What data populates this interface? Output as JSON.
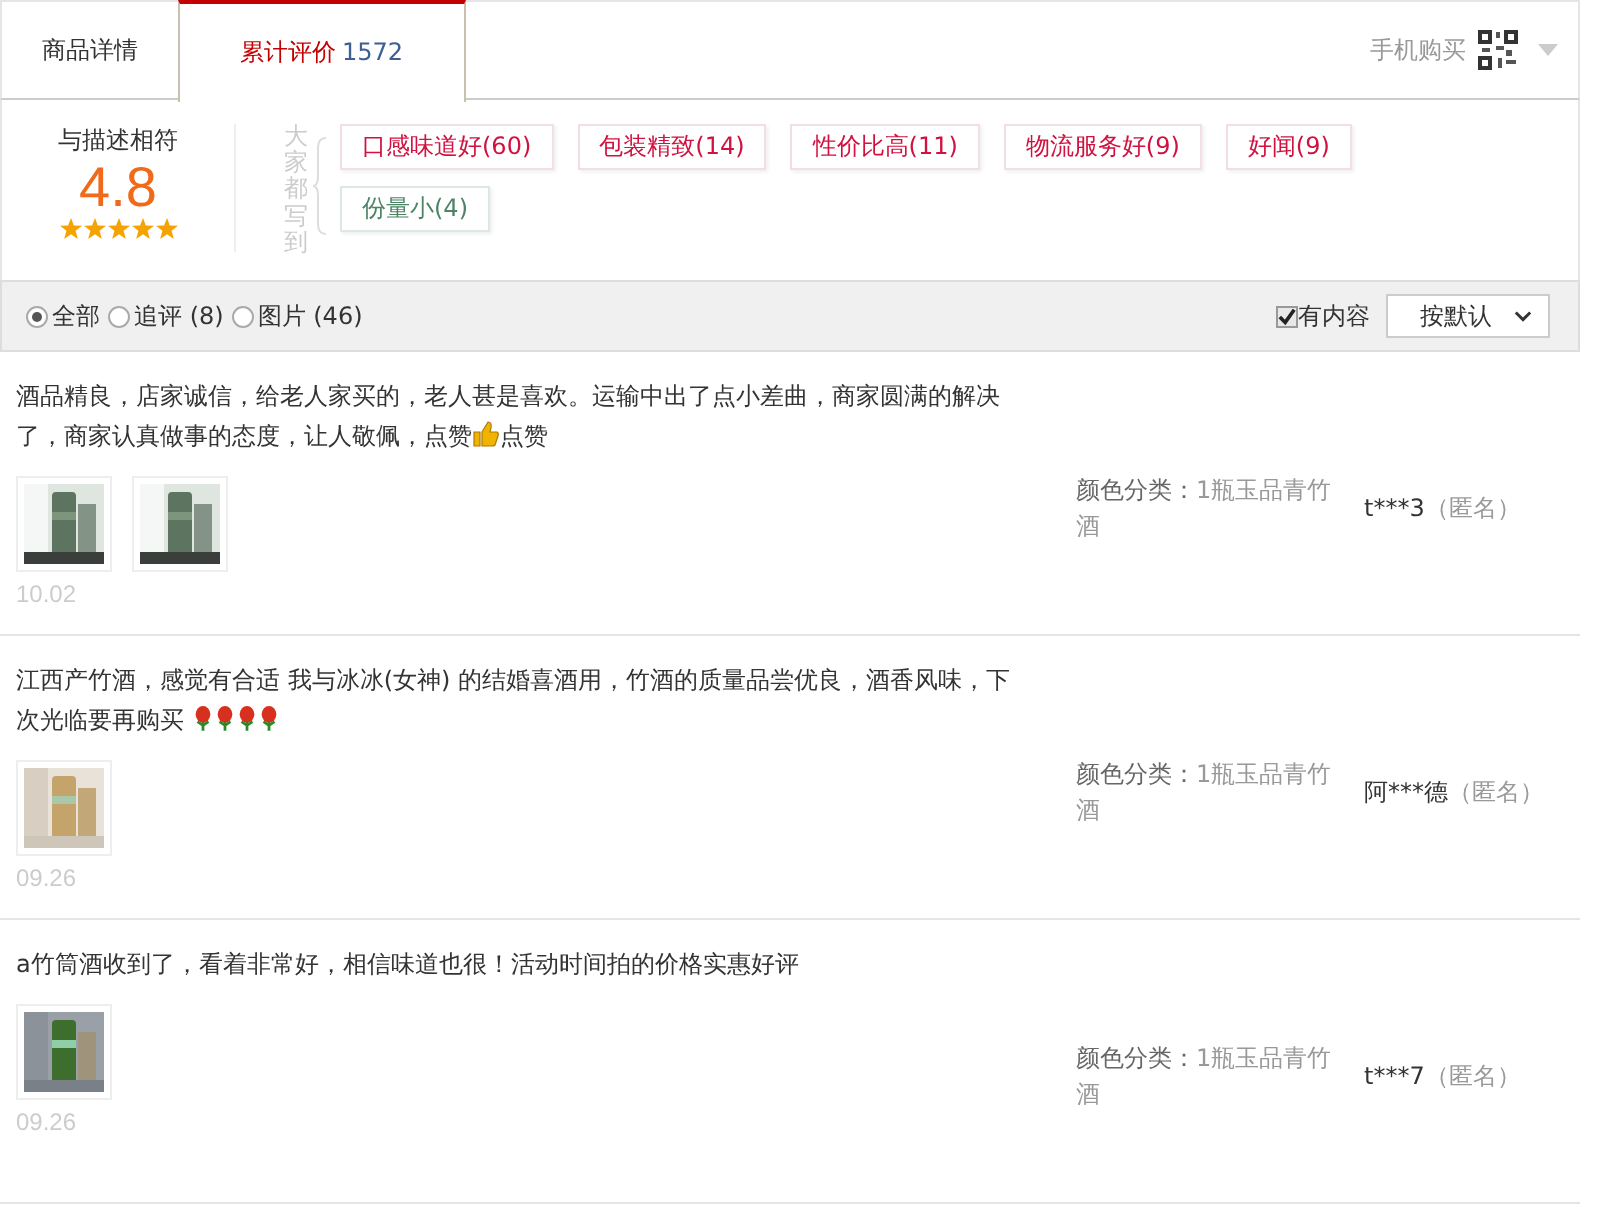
{
  "tabs": [
    {
      "label": "商品详情",
      "selected": false
    },
    {
      "label": "累计评价",
      "count": "1572",
      "selected": true
    }
  ],
  "mobile_buy": {
    "label": "手机购买"
  },
  "summary": {
    "label": "与描述相符",
    "score": "4.8",
    "stars": 5,
    "tags_heading": "大家都写到",
    "tags": [
      {
        "label": "口感味道好(60)",
        "kind": "positive"
      },
      {
        "label": "包装精致(14)",
        "kind": "positive"
      },
      {
        "label": "性价比高(11)",
        "kind": "positive"
      },
      {
        "label": "物流服务好(9)",
        "kind": "positive"
      },
      {
        "label": "好闻(9)",
        "kind": "positive"
      },
      {
        "label": "份量小(4)",
        "kind": "negative"
      }
    ]
  },
  "filters": [
    {
      "label": "全部",
      "selected": true
    },
    {
      "label": "追评 (8)",
      "selected": false
    },
    {
      "label": "图片 (46)",
      "selected": false
    }
  ],
  "has_content": {
    "label": "有内容",
    "checked": true
  },
  "sort": {
    "label": "按默认"
  },
  "reviews": [
    {
      "content": [
        {
          "kind": "text",
          "text": "酒品精良，店家诚信，给老人家买的，老人甚是喜欢。运输中出了点小差曲，商家圆满的解决了，商家认真做事的态度，让人敬佩，点赞"
        },
        {
          "kind": "thumb"
        },
        {
          "kind": "text",
          "text": "点赞"
        }
      ],
      "photos": [
        {
          "kind": "picture"
        },
        {
          "kind": "picture"
        }
      ],
      "date": "10.02",
      "sku_label": "颜色分类：",
      "sku": "1瓶玉品青竹酒",
      "user": "t***3",
      "anonymous": "（匿名）"
    },
    {
      "content": [
        {
          "kind": "text",
          "text": "江西产竹酒，感觉有合适 我与冰冰(女神) 的结婚喜酒用，竹酒的质量品尝优良，酒香风味，下次光临要再购买 "
        },
        {
          "kind": "rose"
        },
        {
          "kind": "rose"
        },
        {
          "kind": "rose"
        },
        {
          "kind": "rose"
        }
      ],
      "photos": [
        {
          "kind": "picture"
        }
      ],
      "date": "09.26",
      "sku_label": "颜色分类：",
      "sku": "1瓶玉品青竹酒",
      "user": "阿***德",
      "anonymous": "（匿名）"
    },
    {
      "content": [
        {
          "kind": "text",
          "text": "a竹筒酒收到了，看着非常好，相信味道也很！活动时间拍的价格实惠好评"
        }
      ],
      "photos": [
        {
          "kind": "picture"
        }
      ],
      "date": "09.26",
      "sku_label": "颜色分类：",
      "sku": "1瓶玉品青竹酒",
      "user": "t***7",
      "anonymous": "（匿名）"
    }
  ]
}
